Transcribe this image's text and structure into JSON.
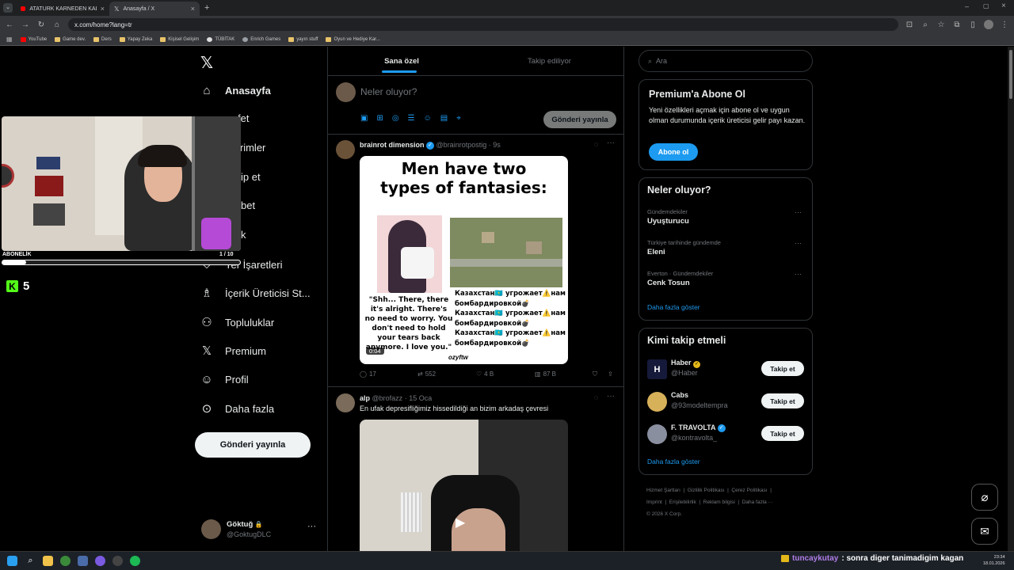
{
  "browser": {
    "tabs": [
      {
        "title": "ATATÜRK KARNEDEN KALDIRI...",
        "active": false
      },
      {
        "title": "Anasayfa / X",
        "active": true
      }
    ],
    "url": "x.com/home?lang=tr",
    "bookmarks": [
      "YouTube",
      "Game dev.",
      "Ders",
      "Yapay Zeka",
      "Kişisel Gelişim",
      "TÜBİTAK",
      "Enrich Games",
      "yayın stuff",
      "Oyun ve Hediye Kar..."
    ]
  },
  "nav": {
    "items": [
      "Anasayfa",
      "Keşfet",
      "Bildirimler",
      "Takip et",
      "Sohbet",
      "Grok",
      "Yer İşaretleri",
      "İçerik Üreticisi St...",
      "Topluluklar",
      "Premium",
      "Profil",
      "Daha fazla"
    ],
    "visible_partial": [
      "fet",
      "irimler",
      "ip et",
      "bet",
      "k",
      "Yer İşaretleri"
    ],
    "post_button": "Gönderi yayınla",
    "account": {
      "name": "Göktuğ",
      "handle": "@GoktugDLC"
    }
  },
  "stream_overlay": {
    "label": "ABONELİK",
    "progress_text": "1 / 10",
    "progress": 0.1,
    "kick_count": "5"
  },
  "feed": {
    "tabs": [
      "Sana özel",
      "Takip ediliyor"
    ],
    "compose_placeholder": "Neler oluyor?",
    "compose_button": "Gönderi yayınla",
    "posts": [
      {
        "name": "brainrot dimension",
        "handle": "@brainrotpostig",
        "time": "9s",
        "meme_title": "Men have two types of fantasies:",
        "meme_left_text": "\"Shh... There, there it's alright. There's no need to worry. You don't need to hold your tears back anymore. I love you.\"",
        "meme_right_text": [
          "Казахстан🇰🇿 угрожает⚠️нам бомбардировкой💣",
          "Казахстан🇰🇿 угрожает⚠️нам бомбардировкой💣",
          "Казахстан🇰🇿 угрожает⚠️нам бомбардировкой💣"
        ],
        "watermark": "ozyftw",
        "video_time": "0:04",
        "replies": "17",
        "reposts": "552",
        "likes": "4 B",
        "views": "87 B"
      },
      {
        "name": "alp",
        "handle": "@brofazz",
        "time": "15 Oca",
        "text": "En ufak depresifliğimiz hissedildiği an bizim arkadaş çevresi"
      }
    ]
  },
  "sidebar": {
    "search_placeholder": "Ara",
    "premium": {
      "title": "Premium'a Abone Ol",
      "text": "Yeni özellikleri açmak için abone ol ve uygun olman durumunda içerik üreticisi gelir payı kazan.",
      "button": "Abone ol"
    },
    "trends": {
      "title": "Neler oluyor?",
      "items": [
        {
          "context": "Gündemdekiler",
          "topic": "Uyuşturucu"
        },
        {
          "context": "Türkiye tarihinde gündemde",
          "topic": "Eleni"
        },
        {
          "context": "Everton · Gündemdekiler",
          "topic": "Cenk Tosun"
        }
      ],
      "show_more": "Daha fazla göster"
    },
    "who_to_follow": {
      "title": "Kimi takip etmeli",
      "items": [
        {
          "name": "Haber",
          "handle": "@Haber",
          "button": "Takip et"
        },
        {
          "name": "Cabs",
          "handle": "@93modeltempra",
          "button": "Takip et"
        },
        {
          "name": "F. TRAVOLTA",
          "handle": "@kontravolta_",
          "button": "Takip et"
        }
      ],
      "show_more": "Daha fazla göster"
    },
    "footer": [
      "Hizmet Şartları",
      "Gizlilik Politikası",
      "Çerez Politikası",
      "Imprint",
      "Erişilebilirlik",
      "Reklam bilgisi",
      "Daha fazla ···",
      "© 2026 X Corp."
    ]
  },
  "chat_overlay": {
    "user": "tuncaykutay",
    "message": ": sonra diger tanimadigim kagan"
  },
  "taskbar": {
    "time": "23:34",
    "date": "18.01.2026"
  },
  "colors": {
    "accent": "#1d9bf0",
    "kick": "#53fc18",
    "background": "#000000"
  }
}
